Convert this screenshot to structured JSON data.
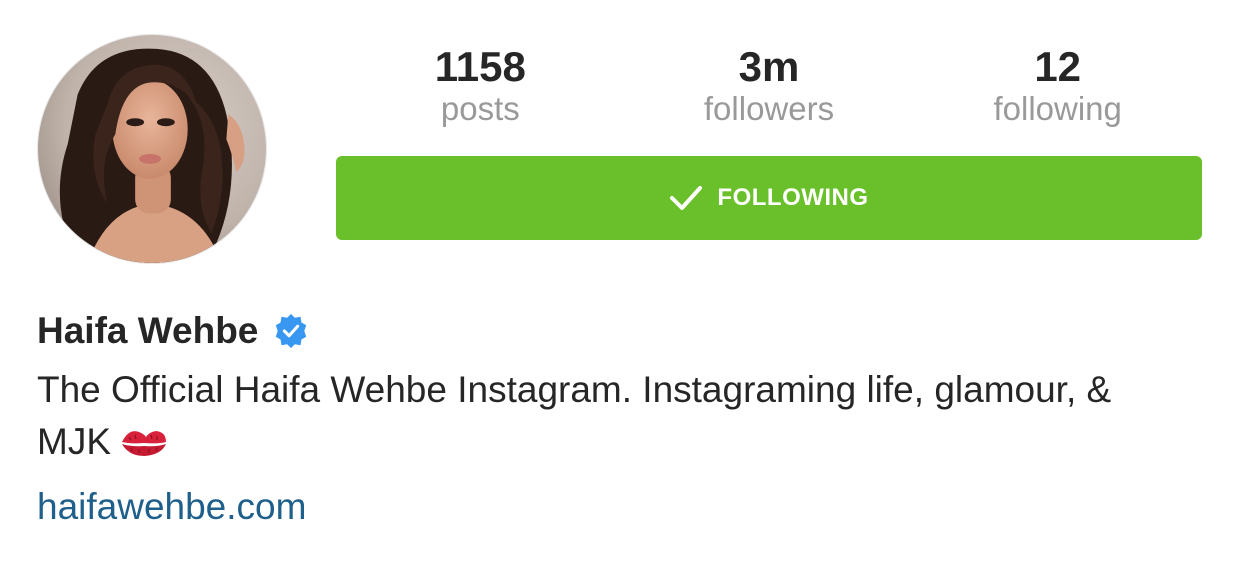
{
  "profile": {
    "name": "Haifa Wehbe",
    "verified": true,
    "bio": "The Official Haifa Wehbe Instagram. Instagraming life, glamour, & MJK",
    "bio_emoji": "kiss-mark-icon",
    "website": "haifawehbe.com"
  },
  "stats": [
    {
      "value": "1158",
      "label": "posts"
    },
    {
      "value": "3m",
      "label": "followers"
    },
    {
      "value": "12",
      "label": "following"
    }
  ],
  "follow_button": {
    "label": "FOLLOWING",
    "color": "#6ac02a"
  },
  "colors": {
    "verified_badge": "#3897f0",
    "link": "#1f5f8b"
  }
}
